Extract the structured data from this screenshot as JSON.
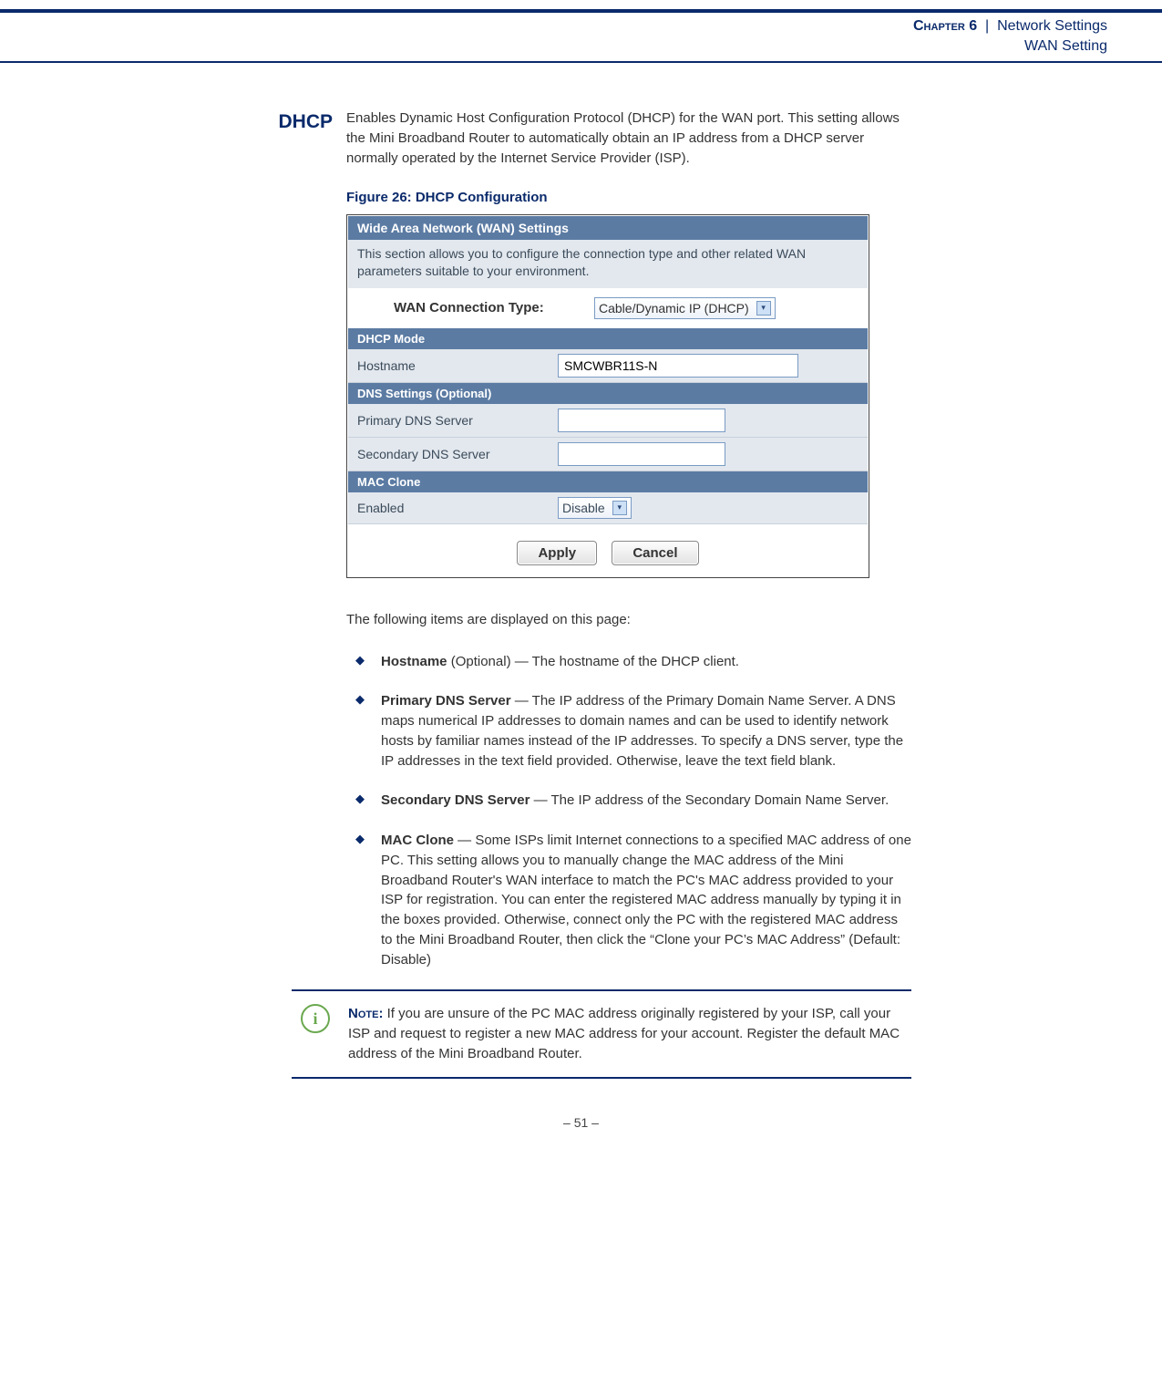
{
  "header": {
    "chapter_label": "Chapter 6",
    "separator": "|",
    "chapter_title": "Network Settings",
    "subtitle": "WAN Setting"
  },
  "section": {
    "heading": "DHCP",
    "intro": "Enables Dynamic Host Configuration Protocol (DHCP) for the WAN port. This setting allows the Mini Broadband Router to automatically obtain an IP address from a DHCP server normally operated by the Internet Service Provider (ISP).",
    "figure_caption": "Figure 26:  DHCP Configuration"
  },
  "screenshot": {
    "panel_title": "Wide Area Network (WAN) Settings",
    "description": "This section allows you to configure the connection type and other related WAN parameters suitable to your environment.",
    "conn_type_label": "WAN Connection Type:",
    "conn_type_value": "Cable/Dynamic IP (DHCP)",
    "sections": {
      "dhcp_mode": "DHCP Mode",
      "dns_settings": "DNS Settings (Optional)",
      "mac_clone": "MAC Clone"
    },
    "fields": {
      "hostname_label": "Hostname",
      "hostname_value": "SMCWBR11S-N",
      "primary_dns_label": "Primary DNS Server",
      "primary_dns_value": "",
      "secondary_dns_label": "Secondary DNS Server",
      "secondary_dns_value": "",
      "enabled_label": "Enabled",
      "enabled_value": "Disable"
    },
    "buttons": {
      "apply": "Apply",
      "cancel": "Cancel"
    }
  },
  "items_intro": "The following items are displayed on this page:",
  "items": [
    {
      "term": "Hostname",
      "desc": " (Optional) — The hostname of the DHCP client."
    },
    {
      "term": "Primary DNS Server",
      "desc": " — The IP address of the Primary Domain Name Server. A DNS maps numerical IP addresses to domain names and can be used to identify network hosts by familiar names instead of the IP addresses. To specify a DNS server, type the IP addresses in the text field provided. Otherwise, leave the text field blank."
    },
    {
      "term": "Secondary DNS Server",
      "desc": " — The IP address of the Secondary Domain Name Server."
    },
    {
      "term": "MAC Clone",
      "desc": " — Some ISPs limit Internet connections to a specified MAC address of one PC. This setting allows you to manually change the MAC address of the Mini Broadband Router's WAN interface to match the PC's MAC address provided to your ISP for registration. You can enter the registered MAC address manually by typing it in the boxes provided. Otherwise, connect only the PC with the registered MAC address to the Mini Broadband Router, then click the “Clone your PC’s MAC Address” (Default: Disable)"
    }
  ],
  "note": {
    "label": "Note:",
    "text": " If you are unsure of the PC MAC address originally registered by your ISP, call your ISP and request to register a new MAC address for your account. Register the default MAC address of the Mini Broadband Router.",
    "icon_glyph": "i"
  },
  "footer": {
    "page_number": "–  51  –"
  }
}
